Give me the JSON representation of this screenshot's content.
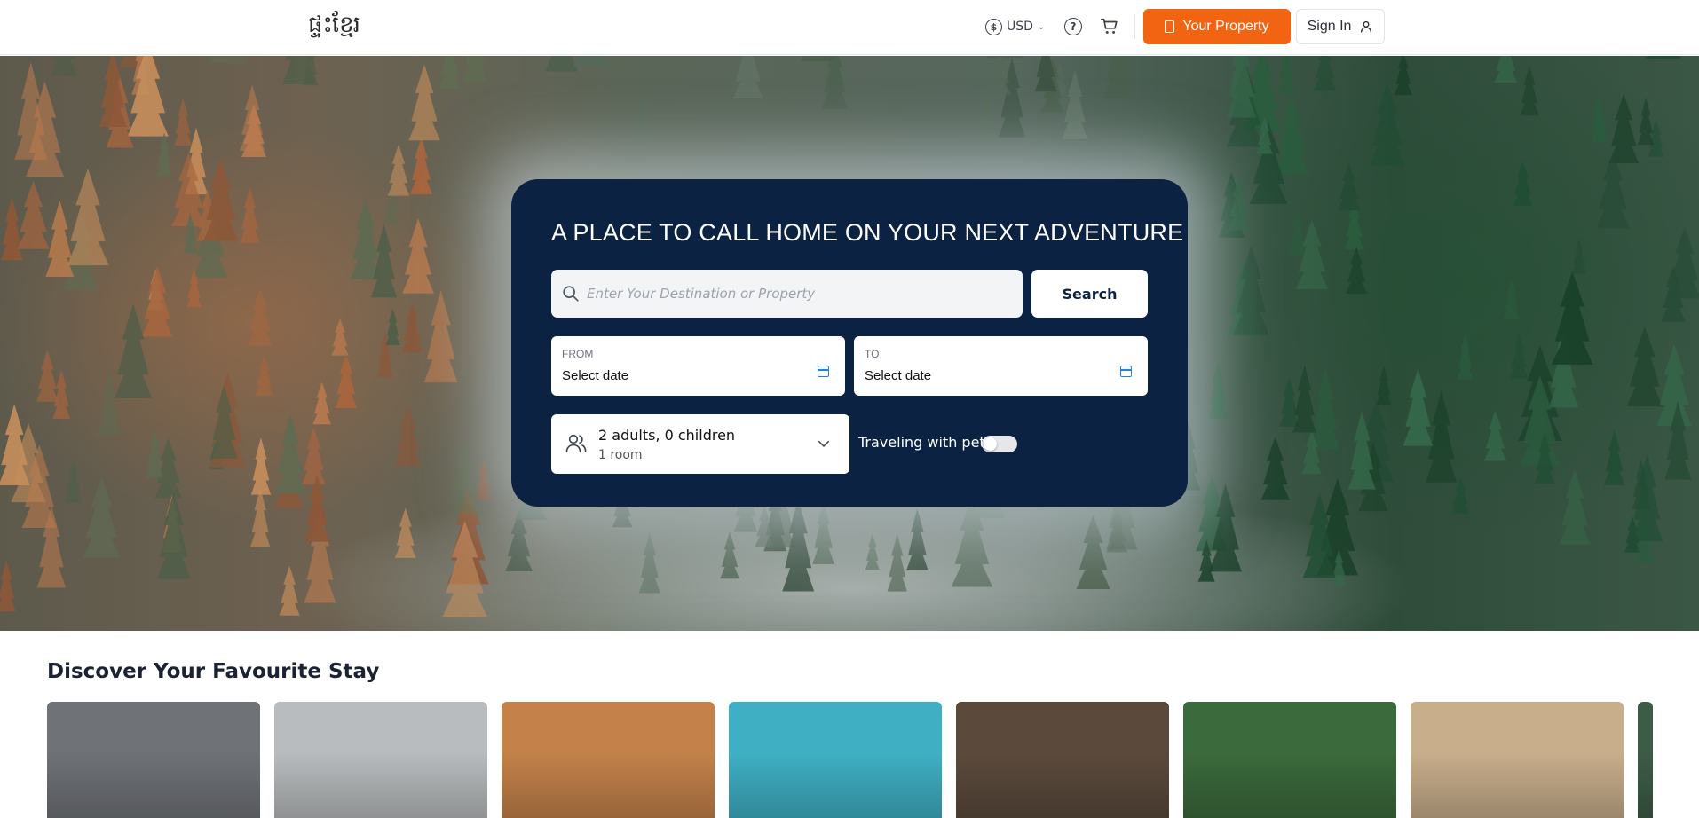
{
  "header": {
    "logo_text": "ផ្ទះខ្មែរ",
    "currency": "USD",
    "property_button": "Your Property",
    "signin_button": "Sign In"
  },
  "hero": {
    "headline": "A PLACE TO CALL HOME ON YOUR NEXT ADVENTURE",
    "search_placeholder": "Enter Your Destination or Property",
    "search_button": "Search",
    "from_label": "FROM",
    "from_value": "Select date",
    "to_label": "TO",
    "to_value": "Select date",
    "guests_main": "2 adults, 0 children",
    "guests_sub": "1 room",
    "pet_label": "Traveling with pet?",
    "pet_toggle_on": false
  },
  "discover": {
    "title": "Discover Your Favourite Stay",
    "cards": [
      {
        "name": "modern-tower",
        "color": "#6f7277"
      },
      {
        "name": "modern-house",
        "color": "#b9bcbe"
      },
      {
        "name": "grand-palace-hotel",
        "color": "#c4824a"
      },
      {
        "name": "overwater-villas",
        "color": "#3fb0c4"
      },
      {
        "name": "forest-cabin",
        "color": "#5b4a3c"
      },
      {
        "name": "jungle-lodge",
        "color": "#3b6a3c"
      },
      {
        "name": "organic-architecture",
        "color": "#c9ae8c"
      },
      {
        "name": "partial-card",
        "color": "#3d5c48"
      }
    ]
  },
  "icons": {
    "currency": "dollar-circle-icon",
    "help": "question-circle-icon",
    "cart": "cart-icon",
    "property": "building-icon",
    "user": "user-icon",
    "search": "search-icon",
    "calendar": "calendar-icon",
    "guests": "users-icon",
    "chevron": "chevron-down-icon"
  },
  "colors": {
    "accent": "#f26411",
    "panel": "#0c2242",
    "calendar": "#2f80d1"
  }
}
